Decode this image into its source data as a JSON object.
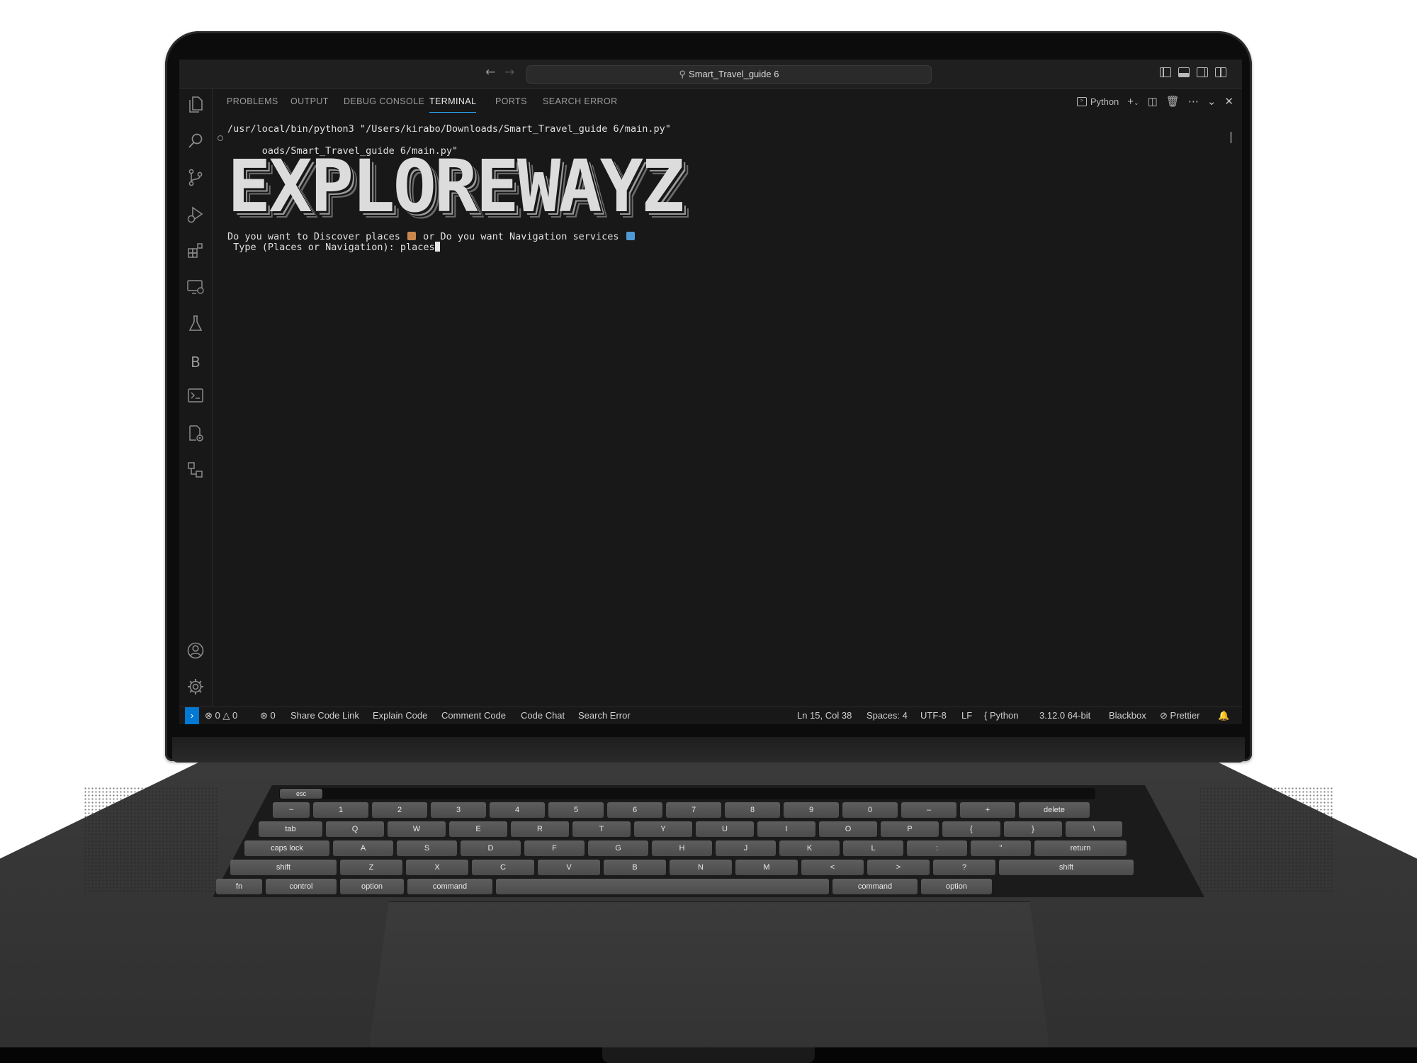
{
  "window": {
    "search_text": "Smart_Travel_guide 6"
  },
  "activity_bar": {
    "icons": [
      "explorer-icon",
      "search-icon",
      "source-control-icon",
      "run-debug-icon",
      "extensions-icon",
      "remote-explorer-icon",
      "testing-icon",
      "blackbox-icon",
      "terminal-icon",
      "settings-sync-icon",
      "diagram-icon",
      "accounts-icon",
      "manage-icon"
    ],
    "blackbox_letter": "B"
  },
  "panel": {
    "tabs": [
      "PROBLEMS",
      "OUTPUT",
      "DEBUG CONSOLE",
      "TERMINAL",
      "PORTS",
      "SEARCH ERROR"
    ],
    "active_tab": "TERMINAL",
    "terminal_profile": "Python"
  },
  "terminal": {
    "command_line": "/usr/local/bin/python3 \"/Users/kirabo/Downloads/Smart_Travel_guide 6/main.py\"",
    "wrapped_line": "oads/Smart_Travel_guide 6/main.py\"",
    "banner": "EXPLOREWAYZ",
    "prompt_line_1_a": "Do you want to Discover places",
    "prompt_line_1_b": "or Do you want Navigation services",
    "prompt_line_2": " Type (Places or Navigation): places"
  },
  "status_bar": {
    "errors": "0",
    "warnings": "0",
    "ports": "0",
    "items_left": [
      "Share Code Link",
      "Explain Code",
      "Comment Code",
      "Code Chat",
      "Search Error"
    ],
    "cursor_position": "Ln 15, Col 38",
    "indent": "Spaces: 4",
    "encoding": "UTF-8",
    "eol": "LF",
    "language": "Python",
    "interpreter": "3.12.0 64-bit",
    "blackbox": "Blackbox",
    "prettier": "Prettier"
  },
  "keyboard": {
    "row_function": [
      "esc"
    ],
    "row_numbers": [
      "~",
      "1",
      "2",
      "3",
      "4",
      "5",
      "6",
      "7",
      "8",
      "9",
      "0",
      "–",
      "+",
      "delete"
    ],
    "row_top": [
      "tab",
      "Q",
      "W",
      "E",
      "R",
      "T",
      "Y",
      "U",
      "I",
      "O",
      "P",
      "{",
      "}",
      "\\"
    ],
    "row_home": [
      "caps lock",
      "A",
      "S",
      "D",
      "F",
      "G",
      "H",
      "J",
      "K",
      "L",
      ":",
      "\"",
      "return"
    ],
    "row_bottom": [
      "shift",
      "Z",
      "X",
      "C",
      "V",
      "B",
      "N",
      "M",
      "<",
      ">",
      "?",
      "shift"
    ],
    "row_modifiers": [
      "fn",
      "control",
      "option",
      "command",
      "",
      "command",
      "option"
    ]
  },
  "colors": {
    "accent": "#0078d4",
    "tab_underline": "#2aaaff",
    "editor_bg": "#181818",
    "emoji_house": "#c9884b",
    "emoji_map": "#4f9ad6"
  }
}
